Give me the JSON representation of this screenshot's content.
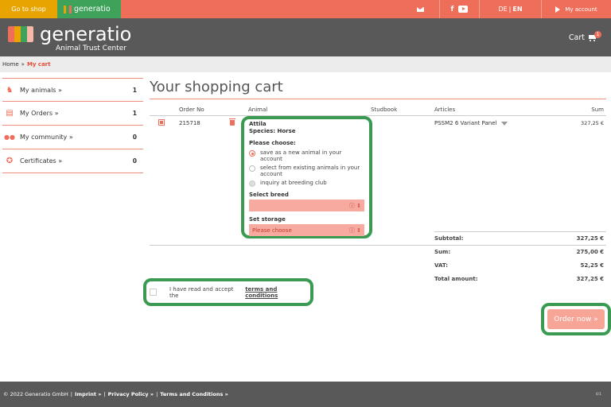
{
  "topbar": {
    "go_to_shop": "Go to shop",
    "generatio_tab": "generatio",
    "lang_de": "DE",
    "lang_sep": "|",
    "lang_en": "EN",
    "my_account": "My account"
  },
  "header": {
    "title": "generatio",
    "subtitle": "Animal Trust Center",
    "cart_label": "Cart",
    "cart_count": "1"
  },
  "breadcrumb": {
    "home": "Home",
    "sep": "»",
    "current": "My cart"
  },
  "sidebar": {
    "items": [
      {
        "label": "My animals »",
        "count": "1",
        "icon": "horse-icon"
      },
      {
        "label": "My Orders »",
        "count": "1",
        "icon": "clipboard-icon"
      },
      {
        "label": "My community »",
        "count": "0",
        "icon": "users-icon"
      },
      {
        "label": "Certificates »",
        "count": "0",
        "icon": "award-icon"
      }
    ]
  },
  "cart": {
    "title": "Your shopping cart",
    "columns": {
      "order_no": "Order No",
      "animal": "Animal",
      "studbook": "Studbook",
      "articles": "Articles",
      "sum": "Sum"
    },
    "row": {
      "order_no": "215718",
      "animal_name": "Attila",
      "species": "Species: Horse",
      "please_choose": "Please choose:",
      "options": [
        "save as a new animal in your account",
        "select from existing animals in your account",
        "inquiry at breeding club"
      ],
      "select_breed_label": "Select breed",
      "select_breed_value": "",
      "set_storage_label": "Set storage",
      "set_storage_value": "Please choose",
      "article": "PSSM2 6 Variant Panel",
      "price": "327,25 €"
    },
    "summary": {
      "subtotal_label": "Subtotal:",
      "subtotal": "327,25 €",
      "sum_label": "Sum:",
      "sum": "275,00 €",
      "vat_label": "VAT:",
      "vat": "52,25 €",
      "total_label": "Total amount:",
      "total": "327,25 €"
    },
    "terms_text": "I have read and accept the",
    "terms_link": "terms and conditions",
    "order_button": "Order now »"
  },
  "footer": {
    "copyright": "© 2022 Generatio GmbH",
    "sep": "|",
    "imprint": "Imprint »",
    "privacy": "Privacy Policy »",
    "terms": "Terms and Conditions »",
    "version": "4/1"
  },
  "colors": {
    "accent": "#ee6e5a",
    "shop_button": "#e8a400",
    "generatio_tab": "#3fa25a",
    "header_bg": "#595959",
    "highlight": "#3a9a52"
  }
}
